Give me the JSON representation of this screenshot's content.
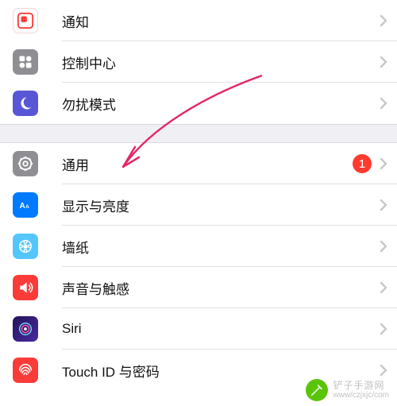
{
  "group1": {
    "notifications": {
      "label": "通知"
    },
    "controlCenter": {
      "label": "控制中心"
    },
    "doNotDisturb": {
      "label": "勿扰模式"
    }
  },
  "group2": {
    "general": {
      "label": "通用",
      "badge": "1"
    },
    "displayBrightness": {
      "label": "显示与亮度"
    },
    "wallpaper": {
      "label": "墙纸"
    },
    "soundsHaptics": {
      "label": "声音与触感"
    },
    "siri": {
      "label": "Siri"
    },
    "touchID": {
      "label": "Touch ID 与密码"
    }
  },
  "watermark": {
    "line1": "铲子手游网",
    "line2": "www/czjxjc/com"
  },
  "colors": {
    "red": "#fa3c39",
    "blue": "#007aff",
    "lightblue": "#54c6fc",
    "gray": "#8e8e93",
    "purple": "#5856d6",
    "green": "#5ac40a"
  }
}
